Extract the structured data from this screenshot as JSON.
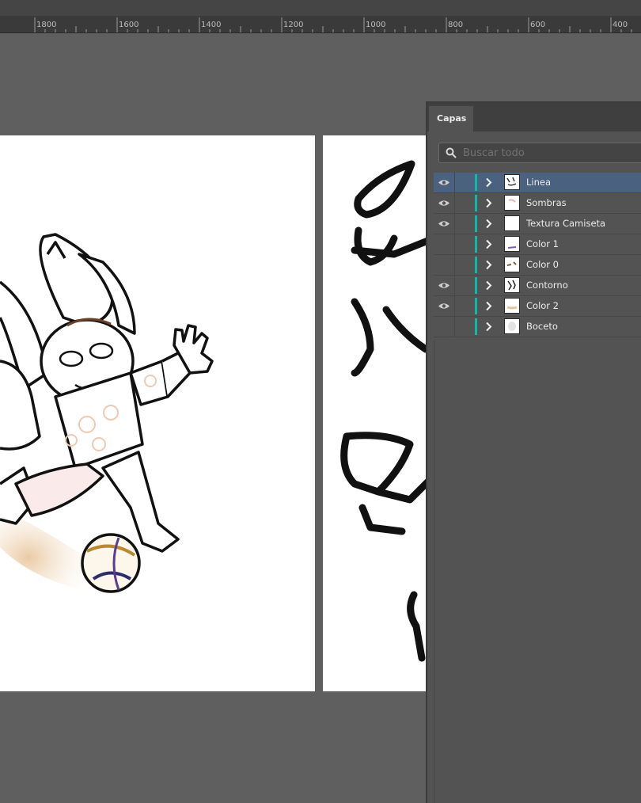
{
  "ruler": {
    "labels": [
      "1800",
      "1600",
      "1400",
      "1200",
      "1000",
      "800",
      "600",
      "400"
    ]
  },
  "panel": {
    "tab_label": "Capas",
    "search": {
      "placeholder": "Buscar todo",
      "value": ""
    }
  },
  "layers": [
    {
      "name": "Linea",
      "visible": true,
      "selected": true
    },
    {
      "name": "Sombras",
      "visible": true,
      "selected": false
    },
    {
      "name": "Textura Camiseta",
      "visible": true,
      "selected": false
    },
    {
      "name": "Color 1",
      "visible": false,
      "selected": false
    },
    {
      "name": "Color 0",
      "visible": false,
      "selected": false
    },
    {
      "name": "Contorno",
      "visible": true,
      "selected": false
    },
    {
      "name": "Color 2",
      "visible": true,
      "selected": false
    },
    {
      "name": "Boceto",
      "visible": false,
      "selected": false
    }
  ],
  "colors": {
    "layer_color_tag": "#1ab3a6",
    "selection": "#4a617f"
  }
}
